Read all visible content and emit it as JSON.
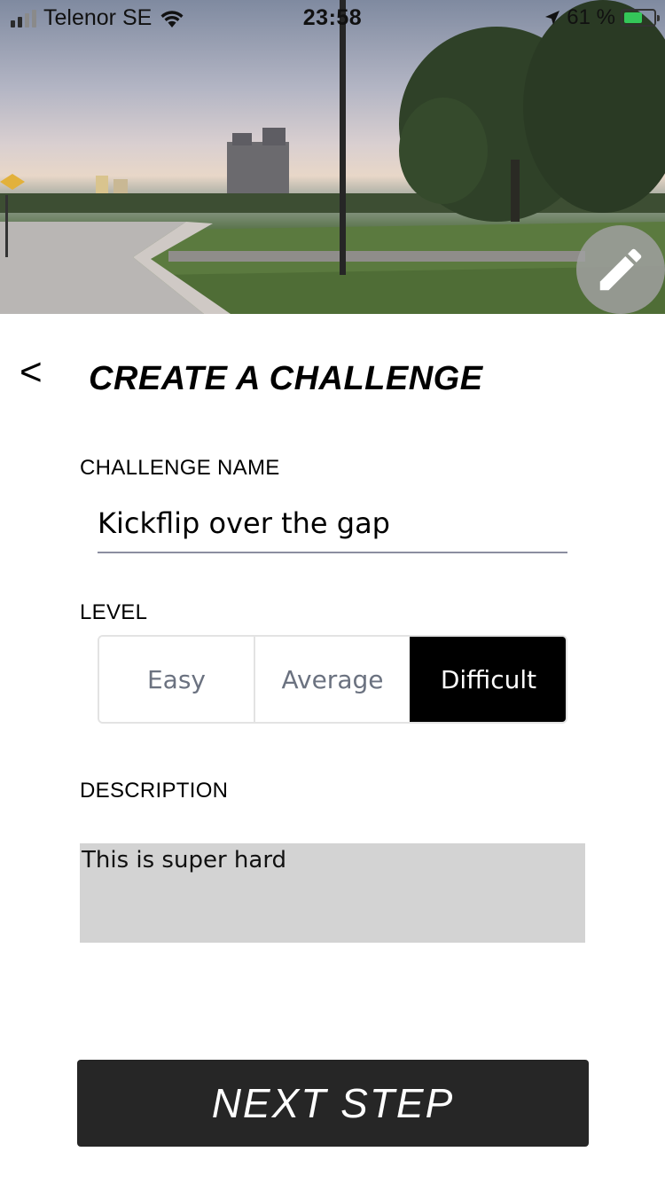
{
  "status_bar": {
    "carrier": "Telenor SE",
    "time": "23:58",
    "battery_percent": "61 %",
    "battery_level": 0.61,
    "signal_bars_filled": 2,
    "signal_bars_total": 4
  },
  "hero": {
    "edit_icon": "pencil-icon"
  },
  "header": {
    "back_label": "<",
    "title": "CREATE A CHALLENGE"
  },
  "form": {
    "name_label": "CHALLENGE NAME",
    "name_value": "Kickflip over the gap",
    "level_label": "LEVEL",
    "levels": [
      "Easy",
      "Average",
      "Difficult"
    ],
    "selected_level": "Difficult",
    "description_label": "DESCRIPTION",
    "description_value": "This is super hard"
  },
  "actions": {
    "next_label": "NEXT STEP"
  },
  "colors": {
    "primary_dark": "#262626",
    "selected_segment": "#000000",
    "description_bg": "#d3d3d3",
    "battery_green": "#34c759"
  }
}
